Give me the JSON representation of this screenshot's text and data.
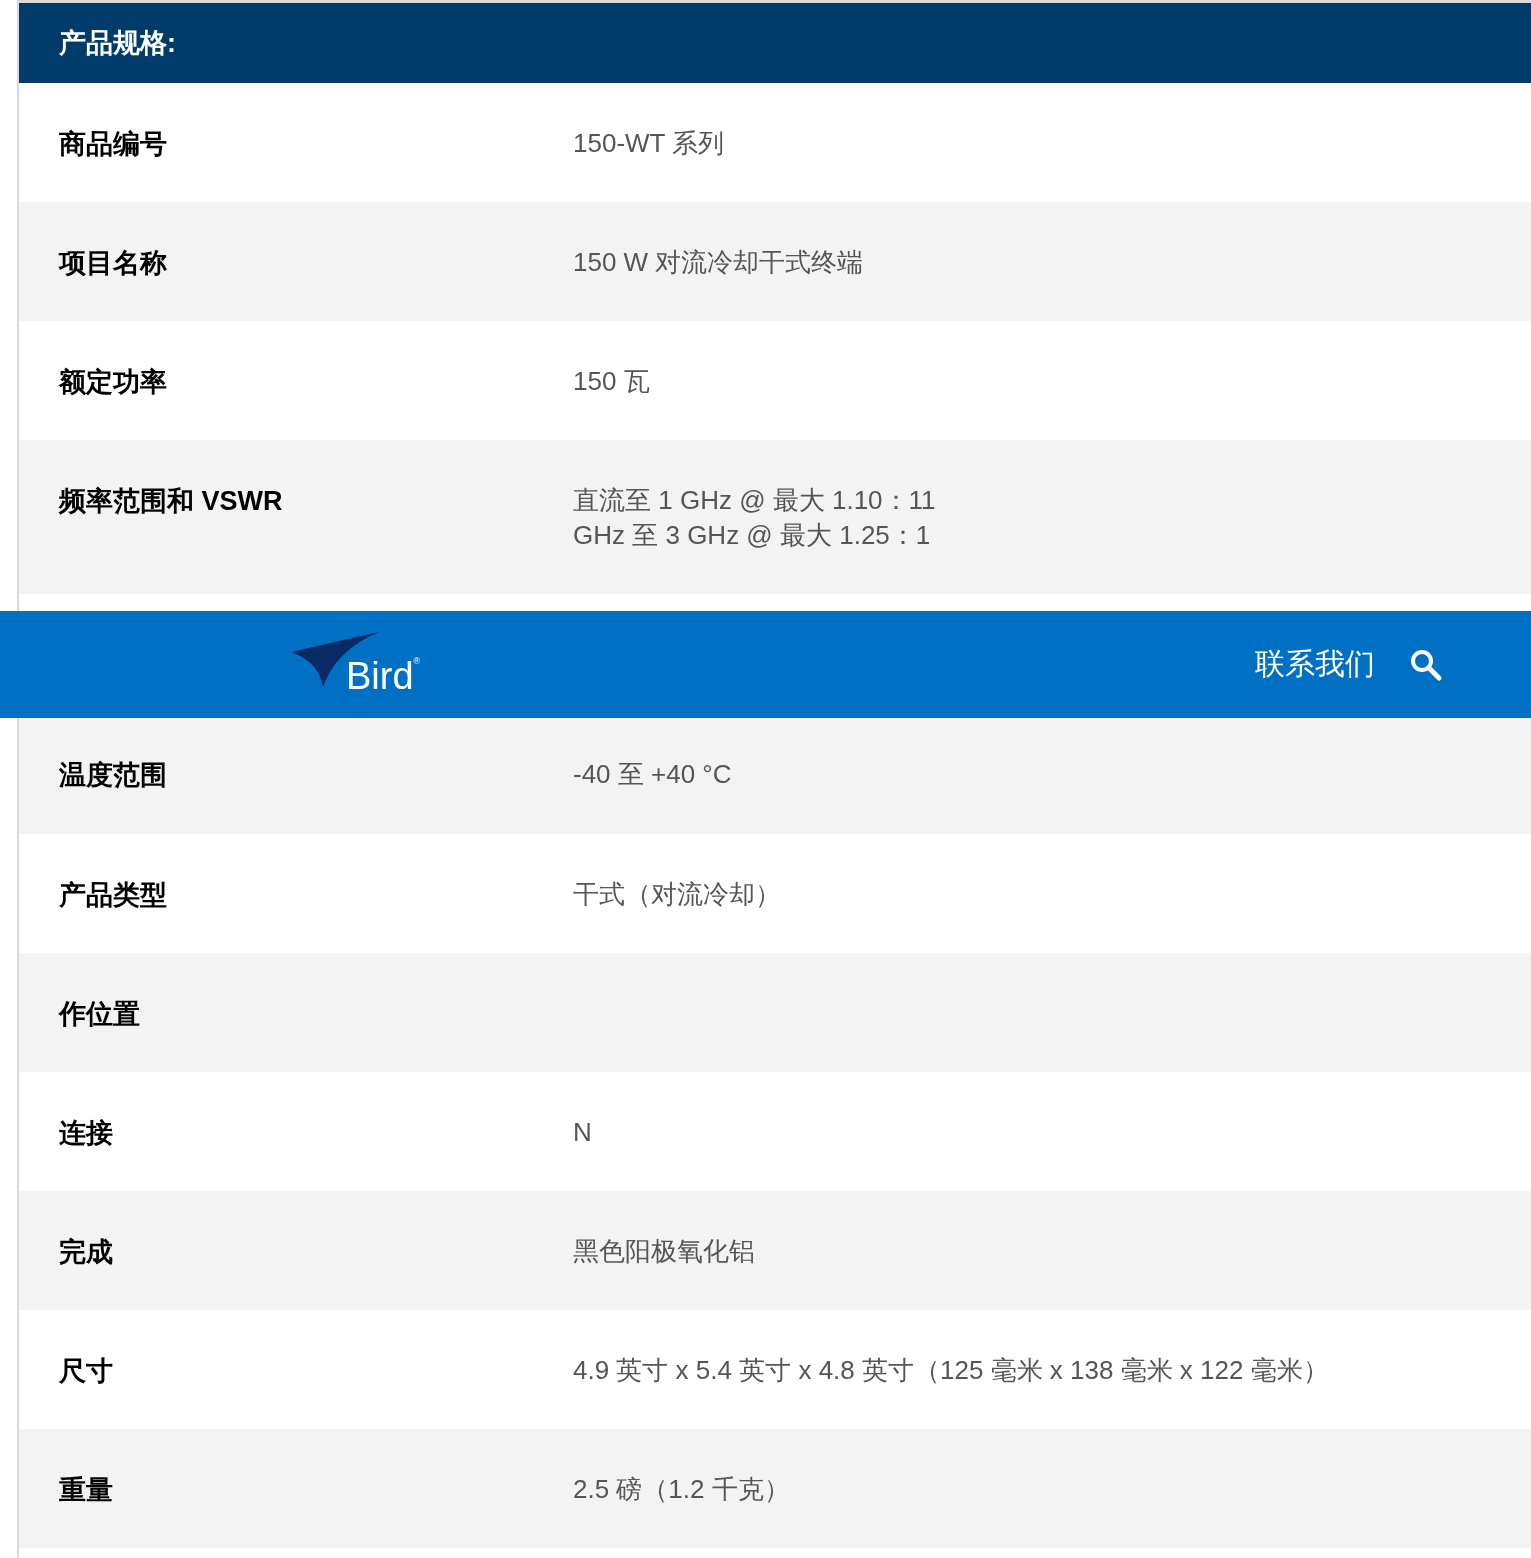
{
  "section_title": "产品规格:",
  "specs_top": [
    {
      "label": "商品编号",
      "lines": [
        "150-WT 系列"
      ]
    },
    {
      "label": "项目名称",
      "lines": [
        "150 W 对流冷却干式终端"
      ]
    },
    {
      "label": "额定功率",
      "lines": [
        "150 瓦"
      ]
    },
    {
      "label": "频率范围和 VSWR",
      "lines": [
        "直流至 1 GHz @ 最大 1.10：11",
        "GHz 至 3 GHz @ 最大 1.25：1"
      ]
    }
  ],
  "navbar": {
    "logo_text": "Bird",
    "logo_mark": "®",
    "links": [
      "联系我们"
    ]
  },
  "specs_bottom": [
    {
      "label": "温度范围",
      "lines": [
        "-40 至 +40 °C"
      ]
    },
    {
      "label": "产品类型",
      "lines": [
        "干式（对流冷却）"
      ]
    },
    {
      "label": "作位置"
    },
    {
      "label": "连接",
      "lines": [
        "N"
      ]
    },
    {
      "label": "完成",
      "lines": [
        "黑色阳极氧化铝"
      ]
    },
    {
      "label": "尺寸",
      "lines": [
        "4.9 英寸 x 5.4 英寸 x 4.8 英寸（125 毫米 x 138 毫米 x 122 毫米）"
      ]
    },
    {
      "label": "重量",
      "lines": [
        "2.5 磅（1.2 千克）"
      ]
    }
  ]
}
